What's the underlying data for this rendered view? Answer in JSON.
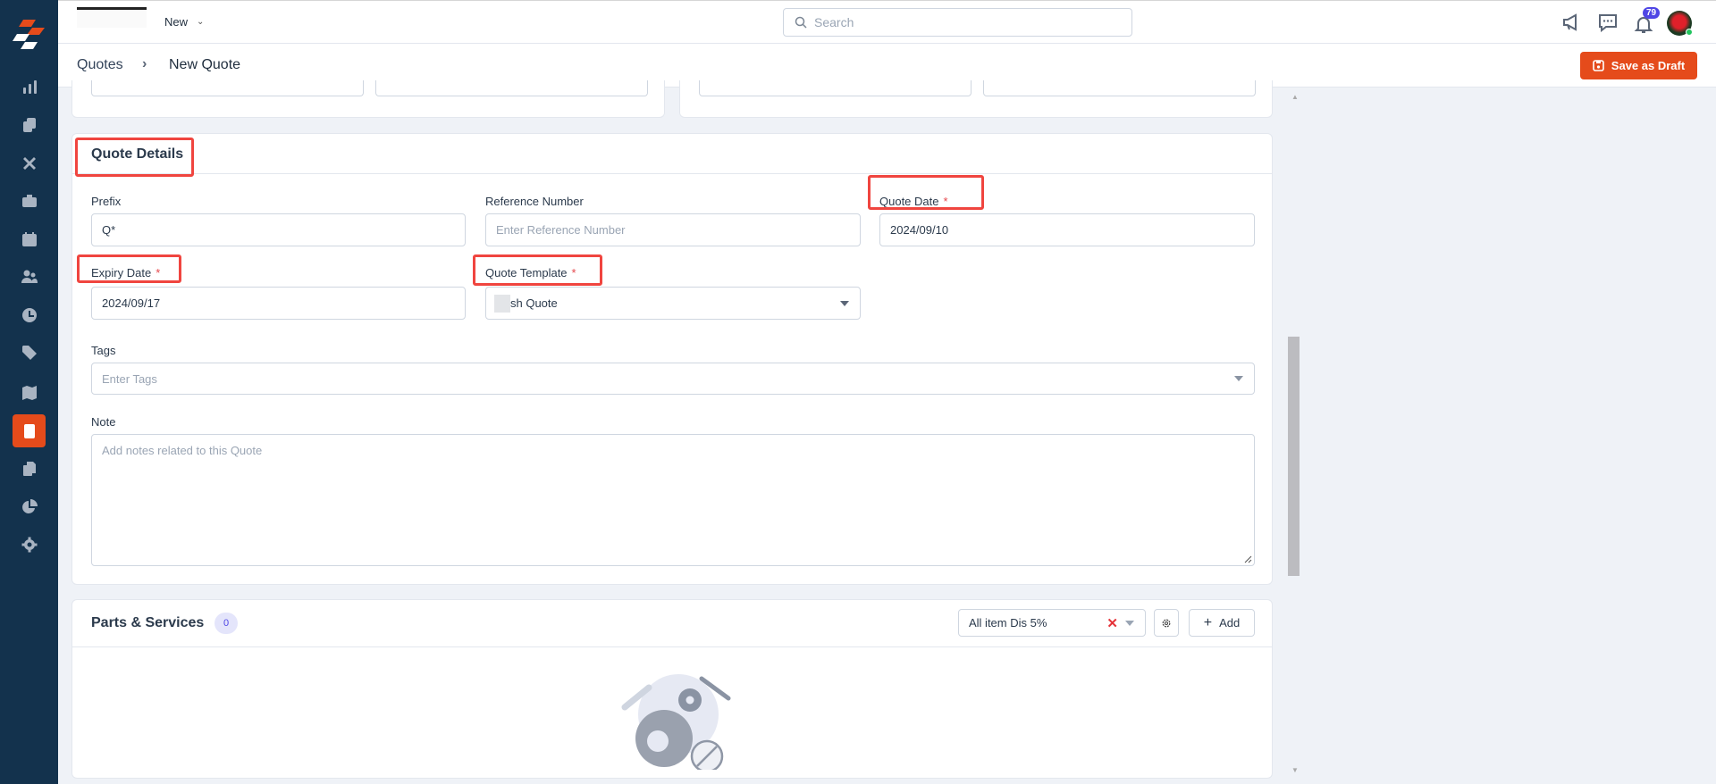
{
  "topbar": {
    "menu_label": "New",
    "search_placeholder": "Search",
    "notification_count": "79"
  },
  "breadcrumb": {
    "parent": "Quotes",
    "current": "New Quote"
  },
  "actions": {
    "save_draft": "Save as Draft"
  },
  "quote_details": {
    "title": "Quote Details",
    "prefix": {
      "label": "Prefix",
      "value": "Q*"
    },
    "reference": {
      "label": "Reference Number",
      "placeholder": "Enter Reference Number"
    },
    "quote_date": {
      "label": "Quote Date",
      "required": "*",
      "value": "2024/09/10"
    },
    "expiry_date": {
      "label": "Expiry Date",
      "required": "*",
      "value": "2024/09/17"
    },
    "template": {
      "label": "Quote Template",
      "required": "*",
      "value": "sh Quote"
    },
    "tags": {
      "label": "Tags",
      "placeholder": "Enter Tags"
    },
    "note": {
      "label": "Note",
      "placeholder": "Add notes related to this Quote"
    }
  },
  "parts": {
    "title": "Parts & Services",
    "count": "0",
    "discount": "All item Dis 5%",
    "add": "Add"
  },
  "colors": {
    "accent": "#e54b1b",
    "sidebar": "#13324d",
    "annotation": "#f0453f",
    "badge": "#4f46e5"
  }
}
